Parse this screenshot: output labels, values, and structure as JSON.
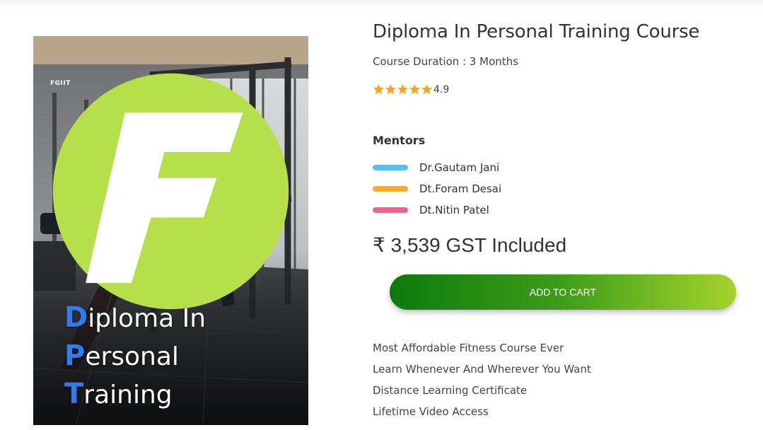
{
  "product": {
    "image": {
      "brand": "FGIIT",
      "title_lines": [
        {
          "cap": "D",
          "rest": "iploma In"
        },
        {
          "cap": "P",
          "rest": "ersonal"
        },
        {
          "cap": "T",
          "rest": "raining"
        }
      ]
    },
    "title": "Diploma In Personal Training Course",
    "duration": "Course Duration : 3 Months",
    "rating": {
      "value": "4.9",
      "stars": 5,
      "star_color": "#f5a623"
    },
    "mentors_heading": "Mentors",
    "mentors": [
      {
        "name": "Dr.Gautam Jani",
        "color": "#4fc3f7"
      },
      {
        "name": "Dt.Foram Desai",
        "color": "#ffa726"
      },
      {
        "name": "Dt.Nitin Patel",
        "color": "#f06292"
      }
    ],
    "price": "₹ 3,539 GST Included",
    "cart_button": "ADD TO CART",
    "features": [
      "Most Affordable Fitness Course Ever",
      "Learn Whenever And Wherever You Want",
      "Distance Learning Certificate",
      "Lifetime Video Access"
    ],
    "colors": {
      "button_start": "#0d7a0d",
      "button_end": "#a5d32e",
      "title_accent": "#2e7cf6"
    }
  }
}
